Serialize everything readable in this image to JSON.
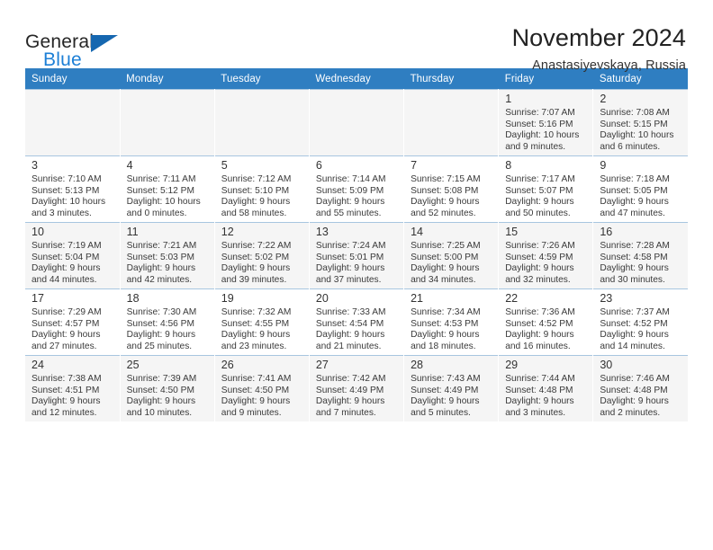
{
  "brand": {
    "word_one": "General",
    "word_two": "Blue",
    "triangle_icon": "triangle-icon",
    "accent_color": "#1c7fd6",
    "triangle_color": "#1667b0"
  },
  "header": {
    "month_title": "November 2024",
    "location": "Anastasiyevskaya, Russia",
    "header_bg_color": "#2f7ec1"
  },
  "calendar": {
    "weekday_headers": [
      "Sunday",
      "Monday",
      "Tuesday",
      "Wednesday",
      "Thursday",
      "Friday",
      "Saturday"
    ],
    "weeks": [
      [
        {
          "day": "",
          "detail": ""
        },
        {
          "day": "",
          "detail": ""
        },
        {
          "day": "",
          "detail": ""
        },
        {
          "day": "",
          "detail": ""
        },
        {
          "day": "",
          "detail": ""
        },
        {
          "day": "1",
          "detail": "Sunrise: 7:07 AM\nSunset: 5:16 PM\nDaylight: 10 hours\nand 9 minutes."
        },
        {
          "day": "2",
          "detail": "Sunrise: 7:08 AM\nSunset: 5:15 PM\nDaylight: 10 hours\nand 6 minutes."
        }
      ],
      [
        {
          "day": "3",
          "detail": "Sunrise: 7:10 AM\nSunset: 5:13 PM\nDaylight: 10 hours\nand 3 minutes."
        },
        {
          "day": "4",
          "detail": "Sunrise: 7:11 AM\nSunset: 5:12 PM\nDaylight: 10 hours\nand 0 minutes."
        },
        {
          "day": "5",
          "detail": "Sunrise: 7:12 AM\nSunset: 5:10 PM\nDaylight: 9 hours\nand 58 minutes."
        },
        {
          "day": "6",
          "detail": "Sunrise: 7:14 AM\nSunset: 5:09 PM\nDaylight: 9 hours\nand 55 minutes."
        },
        {
          "day": "7",
          "detail": "Sunrise: 7:15 AM\nSunset: 5:08 PM\nDaylight: 9 hours\nand 52 minutes."
        },
        {
          "day": "8",
          "detail": "Sunrise: 7:17 AM\nSunset: 5:07 PM\nDaylight: 9 hours\nand 50 minutes."
        },
        {
          "day": "9",
          "detail": "Sunrise: 7:18 AM\nSunset: 5:05 PM\nDaylight: 9 hours\nand 47 minutes."
        }
      ],
      [
        {
          "day": "10",
          "detail": "Sunrise: 7:19 AM\nSunset: 5:04 PM\nDaylight: 9 hours\nand 44 minutes."
        },
        {
          "day": "11",
          "detail": "Sunrise: 7:21 AM\nSunset: 5:03 PM\nDaylight: 9 hours\nand 42 minutes."
        },
        {
          "day": "12",
          "detail": "Sunrise: 7:22 AM\nSunset: 5:02 PM\nDaylight: 9 hours\nand 39 minutes."
        },
        {
          "day": "13",
          "detail": "Sunrise: 7:24 AM\nSunset: 5:01 PM\nDaylight: 9 hours\nand 37 minutes."
        },
        {
          "day": "14",
          "detail": "Sunrise: 7:25 AM\nSunset: 5:00 PM\nDaylight: 9 hours\nand 34 minutes."
        },
        {
          "day": "15",
          "detail": "Sunrise: 7:26 AM\nSunset: 4:59 PM\nDaylight: 9 hours\nand 32 minutes."
        },
        {
          "day": "16",
          "detail": "Sunrise: 7:28 AM\nSunset: 4:58 PM\nDaylight: 9 hours\nand 30 minutes."
        }
      ],
      [
        {
          "day": "17",
          "detail": "Sunrise: 7:29 AM\nSunset: 4:57 PM\nDaylight: 9 hours\nand 27 minutes."
        },
        {
          "day": "18",
          "detail": "Sunrise: 7:30 AM\nSunset: 4:56 PM\nDaylight: 9 hours\nand 25 minutes."
        },
        {
          "day": "19",
          "detail": "Sunrise: 7:32 AM\nSunset: 4:55 PM\nDaylight: 9 hours\nand 23 minutes."
        },
        {
          "day": "20",
          "detail": "Sunrise: 7:33 AM\nSunset: 4:54 PM\nDaylight: 9 hours\nand 21 minutes."
        },
        {
          "day": "21",
          "detail": "Sunrise: 7:34 AM\nSunset: 4:53 PM\nDaylight: 9 hours\nand 18 minutes."
        },
        {
          "day": "22",
          "detail": "Sunrise: 7:36 AM\nSunset: 4:52 PM\nDaylight: 9 hours\nand 16 minutes."
        },
        {
          "day": "23",
          "detail": "Sunrise: 7:37 AM\nSunset: 4:52 PM\nDaylight: 9 hours\nand 14 minutes."
        }
      ],
      [
        {
          "day": "24",
          "detail": "Sunrise: 7:38 AM\nSunset: 4:51 PM\nDaylight: 9 hours\nand 12 minutes."
        },
        {
          "day": "25",
          "detail": "Sunrise: 7:39 AM\nSunset: 4:50 PM\nDaylight: 9 hours\nand 10 minutes."
        },
        {
          "day": "26",
          "detail": "Sunrise: 7:41 AM\nSunset: 4:50 PM\nDaylight: 9 hours\nand 9 minutes."
        },
        {
          "day": "27",
          "detail": "Sunrise: 7:42 AM\nSunset: 4:49 PM\nDaylight: 9 hours\nand 7 minutes."
        },
        {
          "day": "28",
          "detail": "Sunrise: 7:43 AM\nSunset: 4:49 PM\nDaylight: 9 hours\nand 5 minutes."
        },
        {
          "day": "29",
          "detail": "Sunrise: 7:44 AM\nSunset: 4:48 PM\nDaylight: 9 hours\nand 3 minutes."
        },
        {
          "day": "30",
          "detail": "Sunrise: 7:46 AM\nSunset: 4:48 PM\nDaylight: 9 hours\nand 2 minutes."
        }
      ]
    ]
  }
}
